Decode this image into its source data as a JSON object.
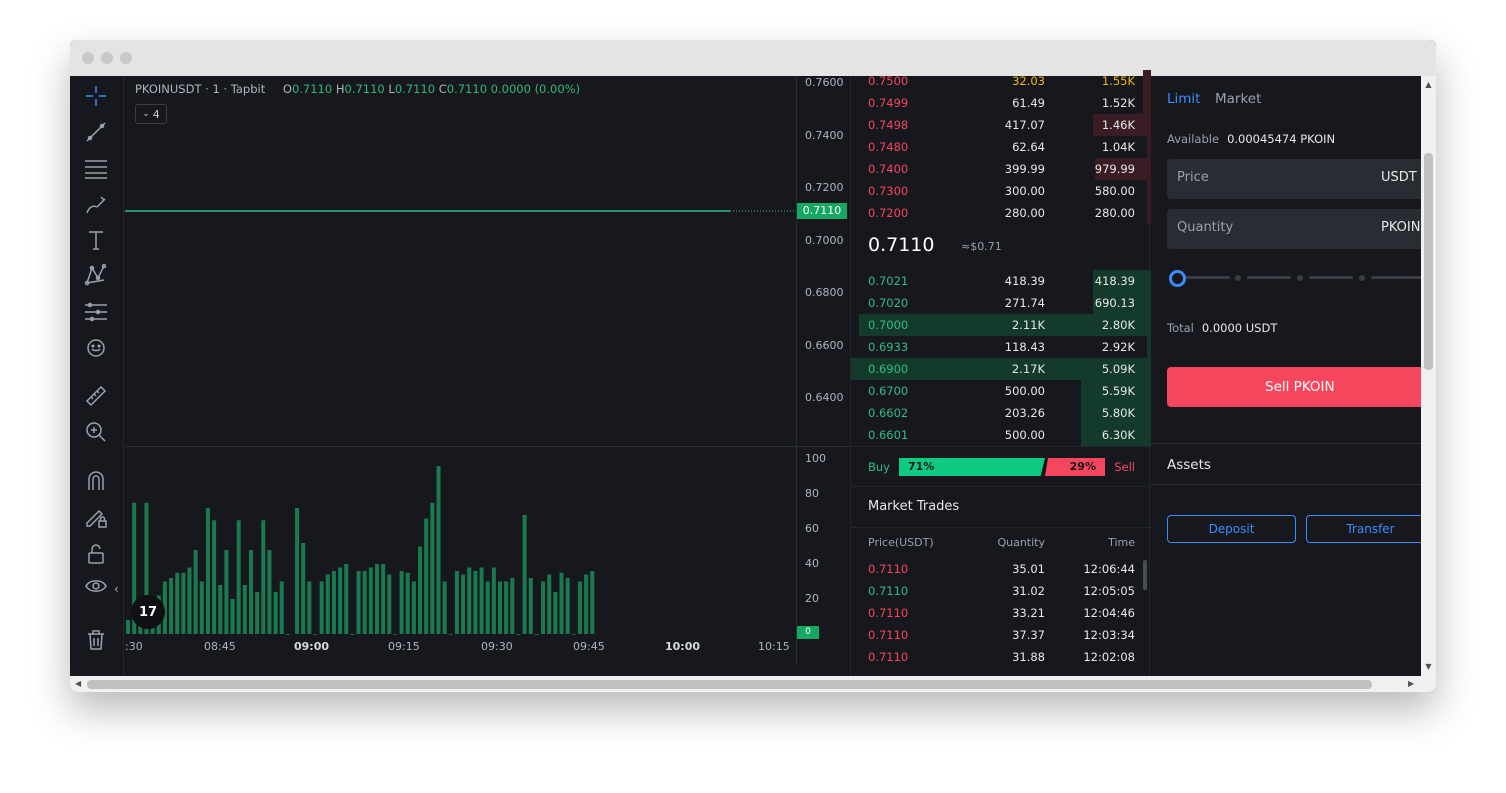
{
  "chart": {
    "symbol": "PKOINUSDT · 1 · Tapbit",
    "ohlc": {
      "o_label": "O",
      "o": "0.7110",
      "h_label": "H",
      "h": "0.7110",
      "l_label": "L",
      "l": "0.7110",
      "c_label": "C",
      "c": "0.7110",
      "change": "0.0000 (0.00%)"
    },
    "indicator_count": "4",
    "price_axis": [
      "0.7600",
      "0.7400",
      "0.7200",
      "0.7000",
      "0.6800",
      "0.6600",
      "0.6400"
    ],
    "last_price_tag": "0.7110",
    "volume_axis": [
      "100",
      "80",
      "60",
      "40",
      "20"
    ],
    "volume_tag": "0",
    "time_axis": [
      ":30",
      "08:45",
      "09:00",
      "09:15",
      "09:30",
      "09:45",
      "10:00",
      "10:15"
    ],
    "bold_times": [
      "09:00",
      "10:00"
    ],
    "logo_text": "17",
    "colors": {
      "up": "#15a862",
      "line": "#2fbd85",
      "volume": "#1a7a4f"
    }
  },
  "chart_data": {
    "type": "bar",
    "title": "",
    "ylabel": "",
    "ylim": [
      0,
      100
    ],
    "values": [
      8,
      0,
      75,
      0,
      20,
      75,
      0,
      15,
      22,
      0,
      0,
      0,
      0,
      30,
      0,
      0,
      32,
      35,
      35,
      38,
      0,
      48,
      0,
      0,
      0,
      30,
      0,
      0,
      0,
      0,
      30,
      0,
      0,
      0,
      0,
      0,
      0,
      0,
      0,
      0,
      0,
      0,
      0,
      0,
      0,
      0,
      0,
      0,
      0,
      0,
      0,
      0,
      0,
      0,
      0,
      0,
      0,
      0,
      0,
      0,
      0,
      0,
      0,
      0,
      0,
      0,
      0,
      0,
      0,
      0,
      0,
      0,
      0,
      0,
      0,
      0,
      0,
      0,
      0,
      0,
      0,
      0,
      0,
      0,
      0,
      0,
      0,
      0,
      0,
      0,
      0,
      0,
      0,
      0,
      0,
      0,
      0,
      0,
      0,
      0
    ]
  },
  "volume_bars": [
    8,
    75,
    20,
    75,
    15,
    22,
    30,
    32,
    35,
    35,
    38,
    48,
    30,
    72,
    65,
    28,
    48,
    20,
    65,
    28,
    48,
    24,
    65,
    48,
    24,
    30,
    0,
    72,
    52,
    30,
    0,
    30,
    34,
    36,
    38,
    40,
    0,
    36,
    36,
    38,
    40,
    40,
    34,
    0,
    36,
    35,
    30,
    50,
    66,
    75,
    96,
    30,
    0,
    36,
    34,
    38,
    36,
    38,
    30,
    38,
    30,
    30,
    32,
    0,
    68,
    32,
    0,
    30,
    34,
    24,
    35,
    32,
    0,
    30,
    34,
    36
  ],
  "orderbook": {
    "asks": [
      {
        "price": "0.7500",
        "qty": "32.03",
        "total": "1.55K"
      },
      {
        "price": "0.7499",
        "qty": "61.49",
        "total": "1.52K"
      },
      {
        "price": "0.7498",
        "qty": "417.07",
        "total": "1.46K"
      },
      {
        "price": "0.7480",
        "qty": "62.64",
        "total": "1.04K"
      },
      {
        "price": "0.7400",
        "qty": "399.99",
        "total": "979.99"
      },
      {
        "price": "0.7300",
        "qty": "300.00",
        "total": "580.00"
      },
      {
        "price": "0.7200",
        "qty": "280.00",
        "total": "280.00"
      }
    ],
    "mid_price": "0.7110",
    "mid_usd": "≈$0.71",
    "bids": [
      {
        "price": "0.7021",
        "qty": "418.39",
        "total": "418.39"
      },
      {
        "price": "0.7020",
        "qty": "271.74",
        "total": "690.13"
      },
      {
        "price": "0.7000",
        "qty": "2.11K",
        "total": "2.80K"
      },
      {
        "price": "0.6933",
        "qty": "118.43",
        "total": "2.92K"
      },
      {
        "price": "0.6900",
        "qty": "2.17K",
        "total": "5.09K"
      },
      {
        "price": "0.6700",
        "qty": "500.00",
        "total": "5.59K"
      },
      {
        "price": "0.6602",
        "qty": "203.26",
        "total": "5.80K"
      },
      {
        "price": "0.6601",
        "qty": "500.00",
        "total": "6.30K"
      }
    ],
    "buy_label": "Buy",
    "sell_label": "Sell",
    "buy_pct": "71%",
    "sell_pct": "29%",
    "buy_ratio": 0.71
  },
  "trades": {
    "title": "Market Trades",
    "headers": [
      "Price(USDT)",
      "Quantity",
      "Time"
    ],
    "rows": [
      {
        "price": "0.7110",
        "qty": "35.01",
        "time": "12:06:44",
        "side": "sell"
      },
      {
        "price": "0.7110",
        "qty": "31.02",
        "time": "12:05:05",
        "side": "buy"
      },
      {
        "price": "0.7110",
        "qty": "33.21",
        "time": "12:04:46",
        "side": "sell"
      },
      {
        "price": "0.7110",
        "qty": "37.37",
        "time": "12:03:34",
        "side": "sell"
      },
      {
        "price": "0.7110",
        "qty": "31.88",
        "time": "12:02:08",
        "side": "sell"
      }
    ]
  },
  "form": {
    "tabs": [
      "Limit",
      "Market"
    ],
    "available_label": "Available",
    "available_value": "0.00045474 PKOIN",
    "price_label": "Price",
    "price_unit": "USDT",
    "quantity_label": "Quantity",
    "quantity_unit": "PKOIN",
    "total_label": "Total",
    "total_value": "0.0000 USDT",
    "sell_button": "Sell PKOIN",
    "assets_title": "Assets",
    "deposit_button": "Deposit",
    "transfer_button": "Transfer",
    "accent": "#3d8bff",
    "sell_color": "#f6465d"
  }
}
